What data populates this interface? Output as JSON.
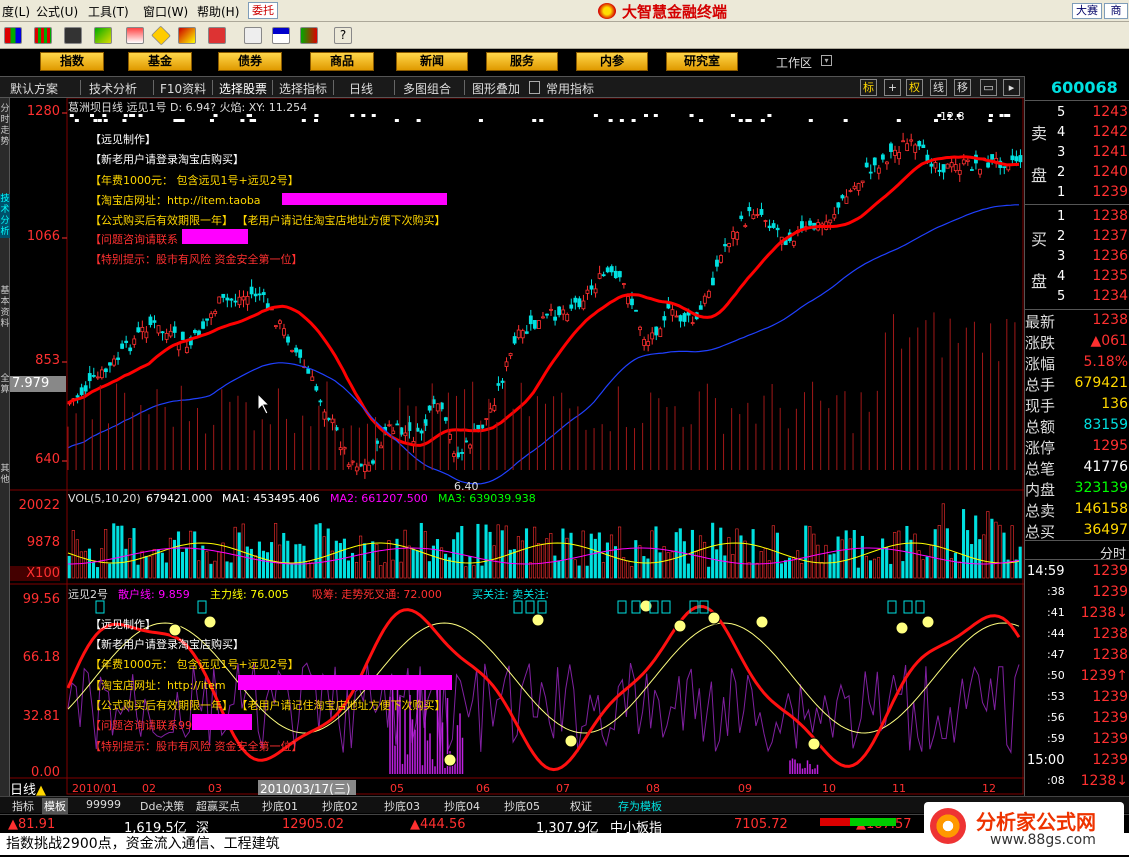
{
  "menubar": {
    "items": [
      "度(L)",
      "公式(U)",
      "工具(T)",
      "窗口(W)",
      "帮助(H)"
    ],
    "entrust_label": "委托",
    "app_title": "大智慧金融终端",
    "right_buttons": [
      "大赛",
      "商"
    ]
  },
  "navbar": {
    "buttons": [
      "指数",
      "基金",
      "债券",
      "商品",
      "新闻",
      "服务",
      "内参",
      "研究室"
    ],
    "workspace_label": "工作区"
  },
  "tabbar": {
    "tabs": [
      "默认方案",
      "技术分析",
      "F10资料",
      "选择股票",
      "选择指标",
      "日线",
      "多图组合",
      "图形叠加",
      "常用指标"
    ],
    "tools": [
      "标",
      "权",
      "线",
      "移"
    ]
  },
  "leftbar": {
    "tabs": [
      "分时走势",
      "技术分析",
      "基本资料",
      "全算",
      "其他"
    ]
  },
  "main_chart": {
    "header": "葛洲坝日线  远见1号  D: 6.94?  火焰: XY: 11.254",
    "y_labels": [
      "1280",
      "1066",
      "853",
      "640"
    ],
    "cursor_value": "7.979",
    "high_label": "12.8",
    "low_label": "6.40",
    "annotations": [
      {
        "text": "【远见制作】",
        "cls": "ann"
      },
      {
        "text": "【新老用户请登录淘宝店购买】",
        "cls": "ann"
      },
      {
        "text": "【年费1000元：  包含远见1号+远见2号】",
        "cls": "yel"
      },
      {
        "text": "【淘宝店网址：http://item.taoba",
        "cls": "yel"
      },
      {
        "text": "【公式购买后有效期限一年】    【老用户请记住淘宝店地址方便下次购买】",
        "cls": "yel"
      },
      {
        "text": "【问题咨询请联系",
        "cls": "red"
      },
      {
        "text": "【特别提示：股市有风险 资金安全第一位】",
        "cls": "red"
      }
    ]
  },
  "vol_chart": {
    "header_prefix": "VOL(5,10,20)",
    "vol_value": "679421.000",
    "ma1": "MA1: 453495.406",
    "ma2": "MA2: 661207.500",
    "ma3": "MA3: 639039.938",
    "y_labels": [
      "20022",
      "9878",
      "X100"
    ]
  },
  "ind_chart": {
    "header_name": "远见2号",
    "retail": "散户线: 9.859",
    "main": "主力线: 76.005",
    "chip": "吸筹: 走势死叉通: 72.000",
    "signal": "买关注:  卖关注:",
    "y_labels": [
      "99.56",
      "66.18",
      "32.81",
      "0.00"
    ],
    "annotations": [
      {
        "text": "【远见制作】",
        "cls": "ann"
      },
      {
        "text": "【新老用户请登录淘宝店购买】",
        "cls": "ann"
      },
      {
        "text": "【年费1000元：  包含远见1号+远见2号】",
        "cls": "yel"
      },
      {
        "text": "【淘宝店网址：http://item",
        "cls": "yel"
      },
      {
        "text": "【公式购买后有效期限一年】    【老用户请记住淘宝店地址方便下次购买】",
        "cls": "yel"
      },
      {
        "text": "【问题咨询请联系99",
        "cls": "red"
      },
      {
        "text": "【特别提示：股市有风险 资金安全第一位】",
        "cls": "red"
      }
    ]
  },
  "xaxis": {
    "period": "日线",
    "labels": [
      "2010/01",
      "02",
      "03",
      "04",
      "05",
      "06",
      "07",
      "08",
      "09",
      "10",
      "11",
      "12"
    ],
    "cursor_date": "2010/03/17(三)"
  },
  "right_panel": {
    "code": "600068",
    "sell_label": [
      "卖",
      "盘"
    ],
    "buy_label": [
      "买",
      "盘"
    ],
    "sell": [
      {
        "lvl": "5",
        "price": "1243",
        "vol": ""
      },
      {
        "lvl": "4",
        "price": "1242",
        "vol": ""
      },
      {
        "lvl": "3",
        "price": "1241",
        "vol": ""
      },
      {
        "lvl": "2",
        "price": "1240",
        "vol": ""
      },
      {
        "lvl": "1",
        "price": "1239",
        "vol": ""
      }
    ],
    "buy": [
      {
        "lvl": "1",
        "price": "1238",
        "vol": ""
      },
      {
        "lvl": "2",
        "price": "1237",
        "vol": ""
      },
      {
        "lvl": "3",
        "price": "1236",
        "vol": ""
      },
      {
        "lvl": "4",
        "price": "1235",
        "vol": ""
      },
      {
        "lvl": "5",
        "price": "1234",
        "vol": ""
      }
    ],
    "stats": [
      {
        "k": "最新",
        "v": "1238",
        "c": "#ff3030"
      },
      {
        "k": "涨跌",
        "v": "▲061",
        "c": "#ff3030"
      },
      {
        "k": "涨幅",
        "v": "5.18%",
        "c": "#ff3030"
      },
      {
        "k": "总手",
        "v": "679421",
        "c": "#ffd700"
      },
      {
        "k": "现手",
        "v": "136",
        "c": "#ffd700"
      },
      {
        "k": "总额",
        "v": "83159",
        "c": "#00e0e0"
      },
      {
        "k": "涨停",
        "v": "1295",
        "c": "#ff3030"
      },
      {
        "k": "总笔",
        "v": "41776",
        "c": "#ffffff"
      },
      {
        "k": "内盘",
        "v": "323139",
        "c": "#00ff00"
      },
      {
        "k": "总卖",
        "v": "146158",
        "c": "#ffd700"
      },
      {
        "k": "总买",
        "v": "36497",
        "c": "#ffd700"
      }
    ],
    "time_header": "分时",
    "ticks": [
      {
        "t": "14:59",
        "p": "1239"
      },
      {
        "t": ":38",
        "p": "1239"
      },
      {
        "t": ":41",
        "p": "1238↓"
      },
      {
        "t": ":44",
        "p": "1238"
      },
      {
        "t": ":47",
        "p": "1238"
      },
      {
        "t": ":50",
        "p": "1239↑"
      },
      {
        "t": ":53",
        "p": "1239"
      },
      {
        "t": ":56",
        "p": "1239"
      },
      {
        "t": ":59",
        "p": "1239"
      },
      {
        "t": "15:00",
        "p": "1239"
      },
      {
        "t": ":08",
        "p": "1238↓"
      }
    ]
  },
  "bottom_tabs": [
    "指标",
    "模板",
    "99999",
    "Dde决策",
    "超赢买点",
    "抄底01",
    "抄底02",
    "抄底03",
    "抄底04",
    "抄底05",
    "权证",
    "存为模板"
  ],
  "status": {
    "v1": "▲81.91",
    "v2": "1,619.5亿",
    "m1": "深",
    "v3": "12905.02",
    "v4": "▲444.56",
    "v5": "1,307.9亿",
    "m2": "中小板指",
    "v6": "7105.72",
    "v7": "▲187.57"
  },
  "ticker": "指数挑战2900点，资金流入通信、工程建筑",
  "watermark": {
    "name": "分析家公式网",
    "url": "www.88gs.com"
  },
  "colors": {
    "up": "#ff3030",
    "down": "#00e0e0",
    "ma": "#ff0000",
    "accent": "#ffd700"
  }
}
